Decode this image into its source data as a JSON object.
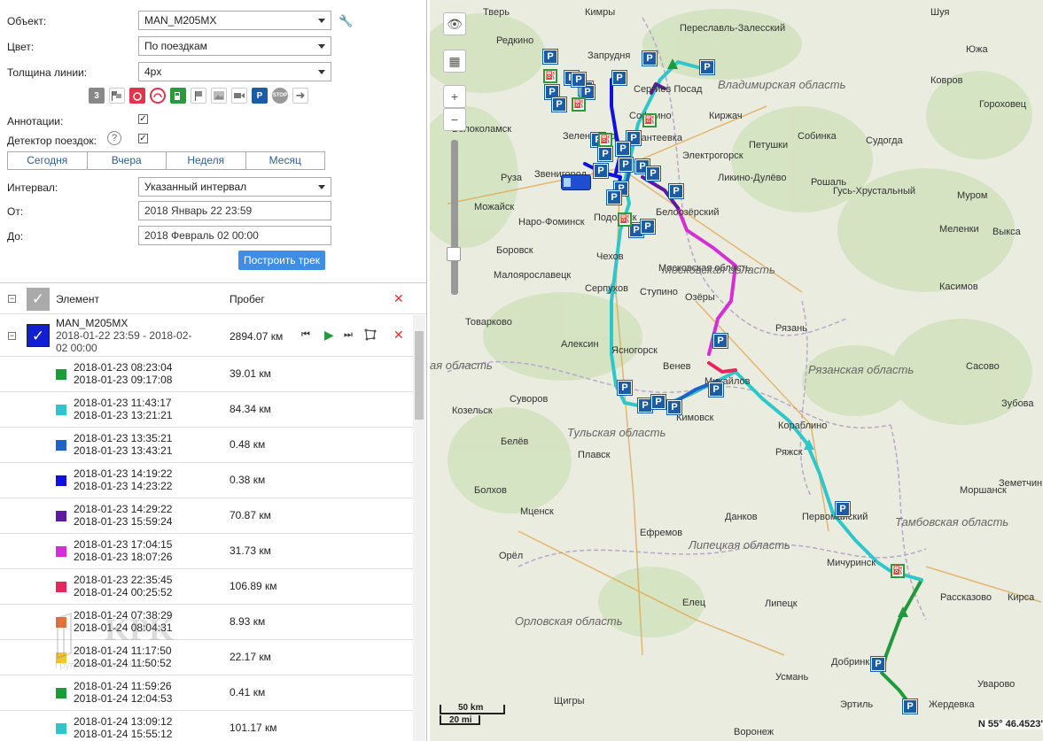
{
  "form": {
    "object_label": "Объект:",
    "object_value": "MAN_M205MX",
    "color_label": "Цвет:",
    "color_value": "По поездкам",
    "width_label": "Толщина линии:",
    "width_value": "4px",
    "annotations_label": "Аннотации:",
    "detector_label": "Детектор поездок:",
    "interval_label": "Интервал:",
    "interval_value": "Указанный интервал",
    "from_label": "От:",
    "from_value": "2018 Январь 22 23:59",
    "to_label": "До:",
    "to_value": "2018 Февраль 02 00:00",
    "build_button": "Построить трек"
  },
  "tabs": [
    "Сегодня",
    "Вчера",
    "Неделя",
    "Месяц"
  ],
  "iconbar": {
    "count_badge": "3",
    "parking_letter": "P",
    "stop_text": "STOP"
  },
  "table": {
    "col_element": "Элемент",
    "col_mileage": "Пробег"
  },
  "object": {
    "name": "MAN_M205MX",
    "period_line1": "2018-01-22  23:59 - 2018-02-",
    "period_line2": "02  00:00",
    "mileage": "2894.07 км"
  },
  "trips": [
    {
      "start": "2018-01-23 08:23:04",
      "end": "2018-01-23 09:17:08",
      "km": "39.01 км",
      "color": "#1f9a3a"
    },
    {
      "start": "2018-01-23 11:43:17",
      "end": "2018-01-23 13:21:21",
      "km": "84.34 км",
      "color": "#2fc6c9"
    },
    {
      "start": "2018-01-23 13:35:21",
      "end": "2018-01-23 13:43:21",
      "km": "0.48 км",
      "color": "#1f63c6"
    },
    {
      "start": "2018-01-23 14:19:22",
      "end": "2018-01-23 14:23:22",
      "km": "0.38 км",
      "color": "#1010e0"
    },
    {
      "start": "2018-01-23 14:29:22",
      "end": "2018-01-23 15:59:24",
      "km": "70.87 км",
      "color": "#5b1aa0"
    },
    {
      "start": "2018-01-23 17:04:15",
      "end": "2018-01-23 18:07:26",
      "km": "31.73 км",
      "color": "#d42ed4"
    },
    {
      "start": "2018-01-23 22:35:45",
      "end": "2018-01-24 00:25:52",
      "km": "106.89 км",
      "color": "#e8265e"
    },
    {
      "start": "2018-01-24 07:38:29",
      "end": "2018-01-24 08:04:31",
      "km": "8.93 км",
      "color": "#e8703a"
    },
    {
      "start": "2018-01-24 11:17:50",
      "end": "2018-01-24 11:50:52",
      "km": "22.17 км",
      "color": "#f2c630"
    },
    {
      "start": "2018-01-24 11:59:26",
      "end": "2018-01-24 12:04:53",
      "km": "0.41 км",
      "color": "#1f9a3a"
    },
    {
      "start": "2018-01-24 13:09:12",
      "end": "2018-01-24 15:55:12",
      "km": "101.17 км",
      "color": "#2fc6c9"
    }
  ],
  "watermark": {
    "brand": "KPK",
    "caption": "Группа компаний КРК"
  },
  "map": {
    "regions": [
      "Владимирская область",
      "Московская область",
      "Рязанская область",
      "Тульская область",
      "Липецкая область",
      "Тамбовская область",
      "Орловская область",
      "ая область",
      "ая область",
      "Орловская область"
    ],
    "cities": [
      "Тверь",
      "Кимры",
      "Переславль-Залесский",
      "Шуя",
      "Редкино",
      "Запрудня",
      "Южа",
      "Сергиев Посад",
      "Ковров",
      "Волоколамск",
      "Софрино",
      "Киржач",
      "Ивантеевка",
      "Зеленоград",
      "Петушки",
      "Собинка",
      "Судогда",
      "Гороховец",
      "Звенигород",
      "Электрогорск",
      "Ликино-Дулёво",
      "Руза",
      "Рошаль",
      "Гусь-Хрустальный",
      "Можайск",
      "Белоозёрский",
      "Муром",
      "Наро-Фоминск",
      "Подольск",
      "Меленки",
      "Выкса",
      "Боровск",
      "Чехов",
      "Малоярославецк",
      "Московская область",
      "Касимов",
      "Серпухов",
      "Ступино",
      "Озёры",
      "Товарково",
      "Рязань",
      "Алексин",
      "Венев",
      "Сасово",
      "Козельск",
      "Суворов",
      "Михайлов",
      "Зубова",
      "Белёв",
      "Кимовск",
      "Кораблино",
      "Плавск",
      "Ряжск",
      "Болхов",
      "Мценск",
      "Данков",
      "Моршанск",
      "Земетчин",
      "Первомайский",
      "Ефремов",
      "Орёл",
      "Мичуринск",
      "Рассказово",
      "Кирса",
      "Елец",
      "Липецк",
      "Добринка",
      "Усмань",
      "Уварово",
      "Щигры",
      "Эртиль",
      "Жердевка",
      "Воронеж",
      "Ясногорск"
    ],
    "scale_km": "50 km",
    "scale_mi": "20 mi",
    "coords": "N 55° 46.4523'",
    "parking_letter": "P",
    "fuel_letter": "⛽",
    "zoom_in": "+",
    "zoom_out": "−"
  }
}
